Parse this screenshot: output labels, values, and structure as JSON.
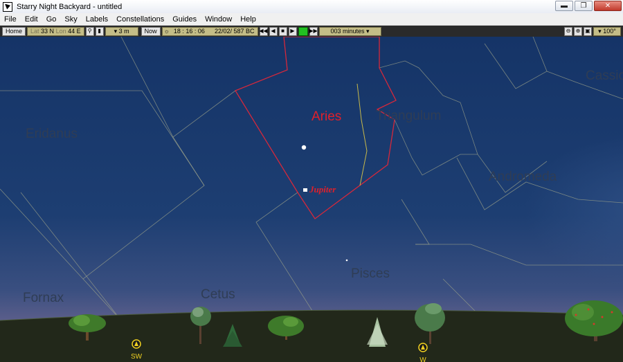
{
  "window": {
    "title": "Starry Night Backyard - untitled",
    "minimize_glyph": "▬",
    "restore_glyph": "❐",
    "close_glyph": "✕"
  },
  "menu": [
    "File",
    "Edit",
    "Go",
    "Sky",
    "Labels",
    "Constellations",
    "Guides",
    "Window",
    "Help"
  ],
  "toolbar": {
    "home_label": "Home",
    "lat_label": "Lat",
    "lat_value": "33 N",
    "lon_label": "Lon",
    "lon_value": "44 E",
    "elevation": "▾ 3 m",
    "now_label": "Now",
    "time": "18 : 16 : 06",
    "date": "22/02/ 587 BC",
    "time_step": "003 minutes ▾",
    "fov": "▾ 100°"
  },
  "sky": {
    "constellations": [
      "Eridanus",
      "Fornax",
      "Cetus",
      "Aries",
      "Triangulum",
      "Andromeda",
      "Pisces",
      "Cassiopeia"
    ],
    "selected_constellation": "Aries",
    "planet_label": "Jupiter",
    "compass": [
      "SW",
      "W"
    ]
  },
  "colors": {
    "sky_top": "#153467",
    "sky_horizon": "#7b6a8c",
    "ground": "#22281a",
    "aries_boundary": "#d6283b",
    "constellation_line": "#9aa08a",
    "label": "#2f3d55",
    "aries_label": "#e0202a",
    "compass": "#f0d020"
  }
}
